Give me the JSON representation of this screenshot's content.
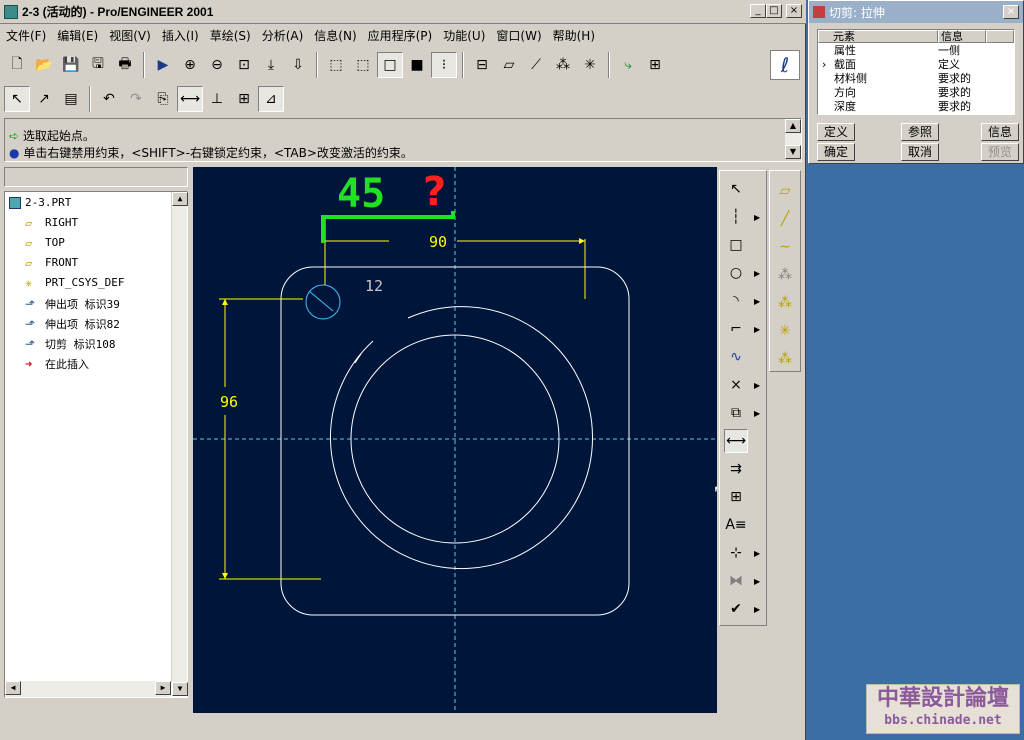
{
  "window": {
    "title": "2-3 (活动的) - Pro/ENGINEER 2001"
  },
  "menu": [
    "文件(F)",
    "编辑(E)",
    "视图(V)",
    "插入(I)",
    "草绘(S)",
    "分析(A)",
    "信息(N)",
    "应用程序(P)",
    "功能(U)",
    "窗口(W)",
    "帮助(H)"
  ],
  "messages": {
    "line1": "选取起始点。",
    "line2": "单击右键禁用约束，<SHIFT>-右键锁定约束，<TAB>改变激活的约束。"
  },
  "tree": {
    "items": [
      "2-3.PRT",
      "RIGHT",
      "TOP",
      "FRONT",
      "PRT_CSYS_DEF",
      "伸出项 标识39",
      "伸出项 标识82",
      "切剪 标识108",
      "在此插入"
    ]
  },
  "sketch": {
    "dim_90": "90",
    "dim_96": "96",
    "dim_12": "12",
    "annotation": "45",
    "question": "?"
  },
  "dialog": {
    "title": "切剪: 拉伸",
    "col_element": "元素",
    "col_info": "信息",
    "rows": [
      {
        "el": "属性",
        "info": "一侧"
      },
      {
        "el": "截面",
        "info": "定义"
      },
      {
        "el": "材料侧",
        "info": "要求的"
      },
      {
        "el": "方向",
        "info": "要求的"
      },
      {
        "el": "深度",
        "info": "要求的"
      }
    ],
    "btn_define": "定义",
    "btn_refs": "参照",
    "btn_info": "信息",
    "btn_ok": "确定",
    "btn_cancel": "取消",
    "btn_preview": "预览"
  },
  "watermark": {
    "line1": "中華設計論壇",
    "line2": "bbs.chinade.net"
  },
  "colors": {
    "canvas": "#00153a",
    "sketch": "#ffffff",
    "dimension": "#ffff00",
    "green_annot": "#22e022",
    "red_annot": "#ff2020",
    "desktop": "#3a6ea5"
  }
}
